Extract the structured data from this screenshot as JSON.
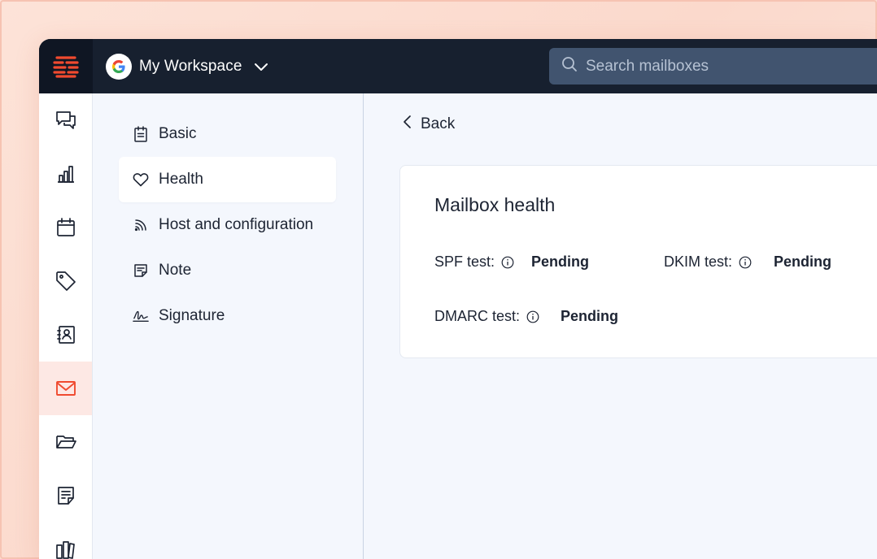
{
  "colors": {
    "accent": "#f04a2f",
    "topbar": "#17202f",
    "active_rail_bg": "#fde8e4"
  },
  "workspace": {
    "name": "My Workspace",
    "badge_icon": "google-g-icon"
  },
  "search": {
    "placeholder": "Search mailboxes"
  },
  "rail": {
    "items": [
      {
        "icon": "chat-icon"
      },
      {
        "icon": "bar-chart-icon"
      },
      {
        "icon": "calendar-icon"
      },
      {
        "icon": "tag-icon"
      },
      {
        "icon": "contacts-icon"
      },
      {
        "icon": "mail-icon",
        "active": true
      },
      {
        "icon": "folder-icon"
      },
      {
        "icon": "note-icon"
      },
      {
        "icon": "books-icon"
      }
    ]
  },
  "subnav": {
    "items": [
      {
        "label": "Basic",
        "icon": "clipboard-icon"
      },
      {
        "label": "Health",
        "icon": "heart-icon",
        "active": true
      },
      {
        "label": "Host and configuration",
        "icon": "signal-icon"
      },
      {
        "label": "Note",
        "icon": "note-icon"
      },
      {
        "label": "Signature",
        "icon": "signature-icon"
      }
    ]
  },
  "main": {
    "back_label": "Back",
    "card": {
      "title": "Mailbox health",
      "tests": [
        {
          "label": "SPF test:",
          "status": "Pending"
        },
        {
          "label": "DKIM test:",
          "status": "Pending"
        },
        {
          "label": "DMARC test:",
          "status": "Pending"
        }
      ]
    }
  }
}
